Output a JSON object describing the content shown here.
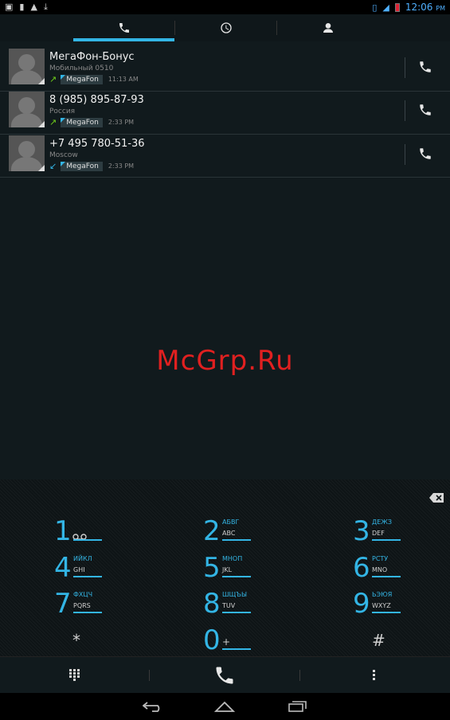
{
  "status_bar": {
    "left_icons": [
      "image-icon",
      "sd-card-icon",
      "warning-icon",
      "download-icon"
    ],
    "right_icons": [
      "vibrate-icon",
      "signal-icon",
      "battery-icon"
    ],
    "time": "12:06",
    "time_suffix": "PM"
  },
  "tabs": [
    {
      "name": "tab-phone",
      "icon": "phone-icon",
      "active": true
    },
    {
      "name": "tab-call-log",
      "icon": "clock-icon",
      "active": false
    },
    {
      "name": "tab-contacts",
      "icon": "person-icon",
      "active": false
    }
  ],
  "calls": [
    {
      "name": "МегаФон-Бонус",
      "detail": "Мобильный 0510",
      "direction": "out",
      "carrier": "MegaFon",
      "time": "11:13 AM"
    },
    {
      "name": "8 (985) 895-87-93",
      "detail": "Россия",
      "direction": "out",
      "carrier": "MegaFon",
      "time": "2:33 PM"
    },
    {
      "name": "+7 495 780-51-36",
      "detail": "Moscow",
      "direction": "in",
      "carrier": "MegaFon",
      "time": "2:33 PM"
    }
  ],
  "watermark": "McGrp.Ru",
  "dialpad": [
    {
      "digit": "1",
      "l1": "",
      "l2": "",
      "voicemail": true
    },
    {
      "digit": "2",
      "l1": "АБВГ",
      "l2": "ABC"
    },
    {
      "digit": "3",
      "l1": "ДЕЖЗ",
      "l2": "DEF"
    },
    {
      "digit": "4",
      "l1": "ИЙКЛ",
      "l2": "GHI"
    },
    {
      "digit": "5",
      "l1": "МНОП",
      "l2": "JKL"
    },
    {
      "digit": "6",
      "l1": "РСТУ",
      "l2": "MNO"
    },
    {
      "digit": "7",
      "l1": "ФХЦЧ",
      "l2": "PQRS"
    },
    {
      "digit": "8",
      "l1": "ШЩЪЫ",
      "l2": "TUV"
    },
    {
      "digit": "9",
      "l1": "ЬЭЮЯ",
      "l2": "WXYZ"
    },
    {
      "digit": "*",
      "l1": "",
      "l2": ""
    },
    {
      "digit": "0",
      "l1": "",
      "l2": "+"
    },
    {
      "digit": "#",
      "l1": "",
      "l2": ""
    }
  ],
  "colors": {
    "accent": "#33b5e5",
    "outgoing_arrow": "#6ecb1a",
    "incoming_arrow": "#33b5e5",
    "watermark": "#e02020"
  }
}
